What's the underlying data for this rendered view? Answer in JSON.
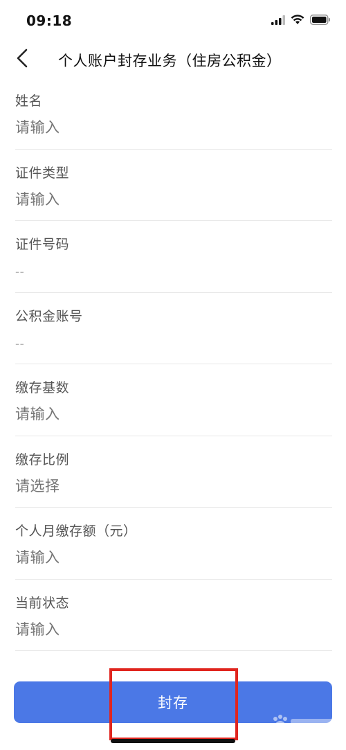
{
  "status_bar": {
    "time": "09:18",
    "icons": [
      "signal-icon",
      "wifi-icon",
      "battery-icon"
    ]
  },
  "nav": {
    "back_icon": "chevron-left-icon",
    "title": "个人账户封存业务（住房公积金）"
  },
  "form": {
    "fields": [
      {
        "label": "姓名",
        "value": "",
        "placeholder": "请输入"
      },
      {
        "label": "证件类型",
        "value": "",
        "placeholder": "请输入"
      },
      {
        "label": "证件号码",
        "value": "--"
      },
      {
        "label": "公积金账号",
        "value": "--"
      },
      {
        "label": "缴存基数",
        "value": "",
        "placeholder": "请输入"
      },
      {
        "label": "缴存比例",
        "value": "",
        "placeholder": "请选择"
      },
      {
        "label": "个人月缴存额（元）",
        "value": "",
        "placeholder": "请输入"
      },
      {
        "label": "当前状态",
        "value": "",
        "placeholder": "请输入"
      }
    ]
  },
  "submit": {
    "label": "封存"
  },
  "colors": {
    "primary": "#4b78e6",
    "highlight": "#e0251e",
    "placeholder": "#c8c8c8",
    "divider": "#e8e8e8"
  }
}
